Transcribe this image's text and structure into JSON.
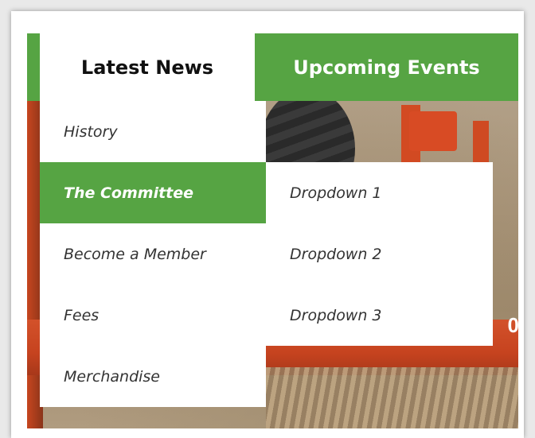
{
  "nav": {
    "tabs": [
      {
        "label": "Latest News",
        "active": true
      },
      {
        "label": "Upcoming Events",
        "active": false
      }
    ]
  },
  "menu": {
    "items": [
      {
        "label": "History"
      },
      {
        "label": "The Committee",
        "highlighted": true
      },
      {
        "label": "Become a Member"
      },
      {
        "label": "Fees"
      },
      {
        "label": "Merchandise"
      }
    ]
  },
  "submenu": {
    "items": [
      {
        "label": "Dropdown 1"
      },
      {
        "label": "Dropdown 2"
      },
      {
        "label": "Dropdown 3"
      }
    ]
  },
  "photo": {
    "overlay_text": "0"
  },
  "colors": {
    "accent_green": "#56a443",
    "menu_background": "#ffffff",
    "text_dark": "#333333"
  }
}
